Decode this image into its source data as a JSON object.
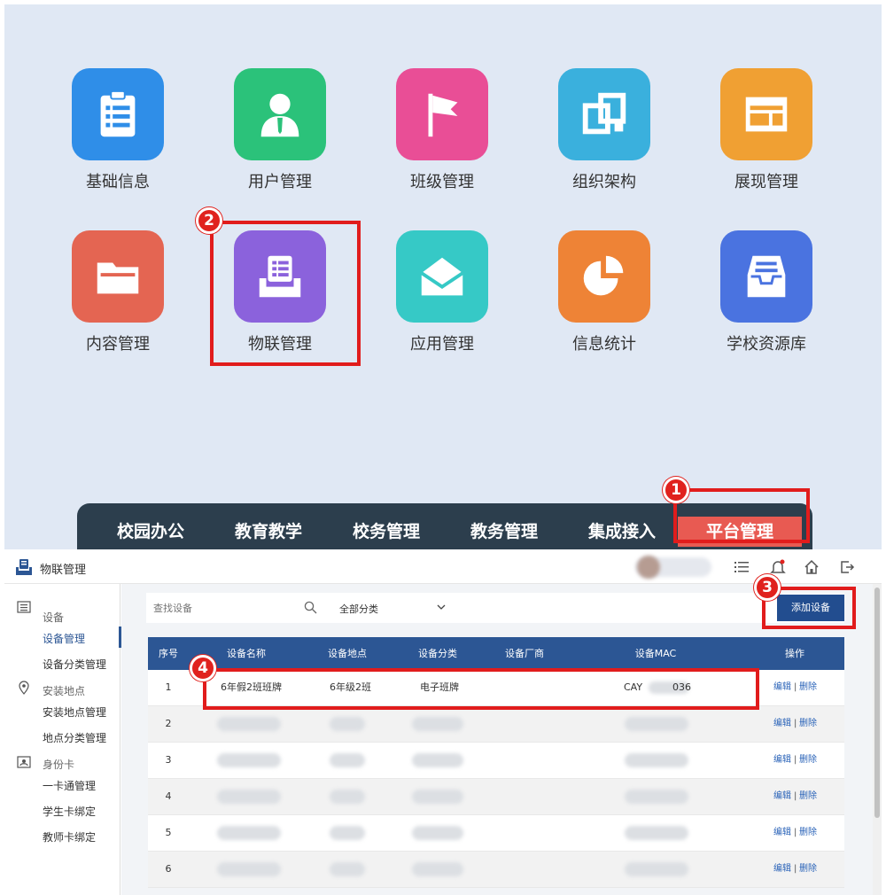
{
  "portal": {
    "apps": [
      {
        "label": "基础信息",
        "icon": "clipboard-list-icon",
        "color": "#2f8ee8"
      },
      {
        "label": "用户管理",
        "icon": "user-tie-icon",
        "color": "#2bc27a"
      },
      {
        "label": "班级管理",
        "icon": "flag-icon",
        "color": "#e94e96"
      },
      {
        "label": "组织架构",
        "icon": "linked-squares-icon",
        "color": "#3ab0dd"
      },
      {
        "label": "展现管理",
        "icon": "layout-icon",
        "color": "#f0a033"
      },
      {
        "label": "内容管理",
        "icon": "folder-icon",
        "color": "#e46552"
      },
      {
        "label": "物联管理",
        "icon": "inbox-device-icon",
        "color": "#8b62dc"
      },
      {
        "label": "应用管理",
        "icon": "envelope-open-icon",
        "color": "#36c9c6"
      },
      {
        "label": "信息统计",
        "icon": "pie-chart-icon",
        "color": "#ee8336"
      },
      {
        "label": "学校资源库",
        "icon": "tray-icon",
        "color": "#4a73e0"
      }
    ],
    "nav": [
      "校园办公",
      "教育教学",
      "校务管理",
      "教务管理",
      "集成接入",
      "平台管理"
    ],
    "active_nav": "平台管理"
  },
  "markers": [
    "1",
    "2",
    "3",
    "4"
  ],
  "window": {
    "title": "物联管理",
    "header_icons": [
      "list-icon",
      "bell-icon",
      "home-icon",
      "logout-icon"
    ]
  },
  "sidebar": {
    "groups": [
      {
        "label": "设备",
        "icon": "device-icon",
        "items": [
          "设备管理",
          "设备分类管理"
        ]
      },
      {
        "label": "安装地点",
        "icon": "location-pin-icon",
        "items": [
          "安装地点管理",
          "地点分类管理"
        ]
      },
      {
        "label": "身份卡",
        "icon": "id-card-icon",
        "items": [
          "一卡通管理",
          "学生卡绑定",
          "教师卡绑定"
        ]
      }
    ],
    "active_item": "设备管理"
  },
  "toolbar": {
    "search_placeholder": "查找设备",
    "category_select": "全部分类",
    "add_button": "添加设备"
  },
  "table": {
    "columns": [
      "序号",
      "设备名称",
      "设备地点",
      "设备分类",
      "设备厂商",
      "设备MAC",
      "操作"
    ],
    "rows": [
      {
        "index": "1",
        "name": "6年假2班班牌",
        "location": "6年级2班",
        "category": "电子班牌",
        "vendor": "",
        "mac_prefix": "CAY",
        "mac_suffix": "036"
      },
      {
        "index": "2"
      },
      {
        "index": "3"
      },
      {
        "index": "4"
      },
      {
        "index": "5"
      },
      {
        "index": "6"
      }
    ],
    "op_edit": "编辑",
    "op_sep": "|",
    "op_delete": "删除"
  }
}
